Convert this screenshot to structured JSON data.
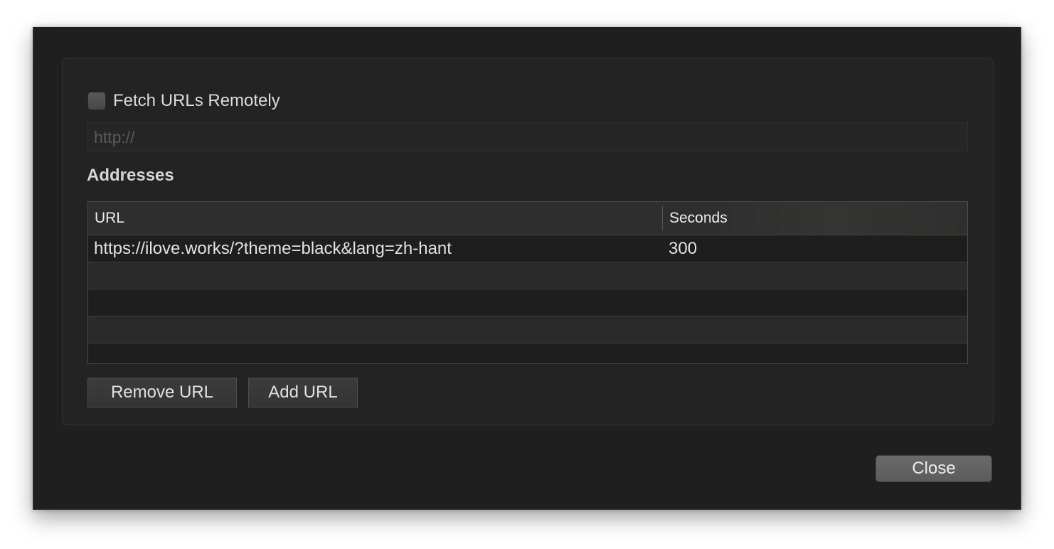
{
  "fetch_remote": {
    "label": "Fetch URLs Remotely",
    "checked": false
  },
  "remote_url": {
    "value": "",
    "placeholder": "http://"
  },
  "addresses": {
    "title": "Addresses",
    "columns": [
      "URL",
      "Seconds"
    ],
    "rows": [
      {
        "url": "https://ilove.works/?theme=black&lang=zh-hant",
        "seconds": "300"
      }
    ]
  },
  "buttons": {
    "remove": "Remove URL",
    "add": "Add URL",
    "close": "Close"
  }
}
